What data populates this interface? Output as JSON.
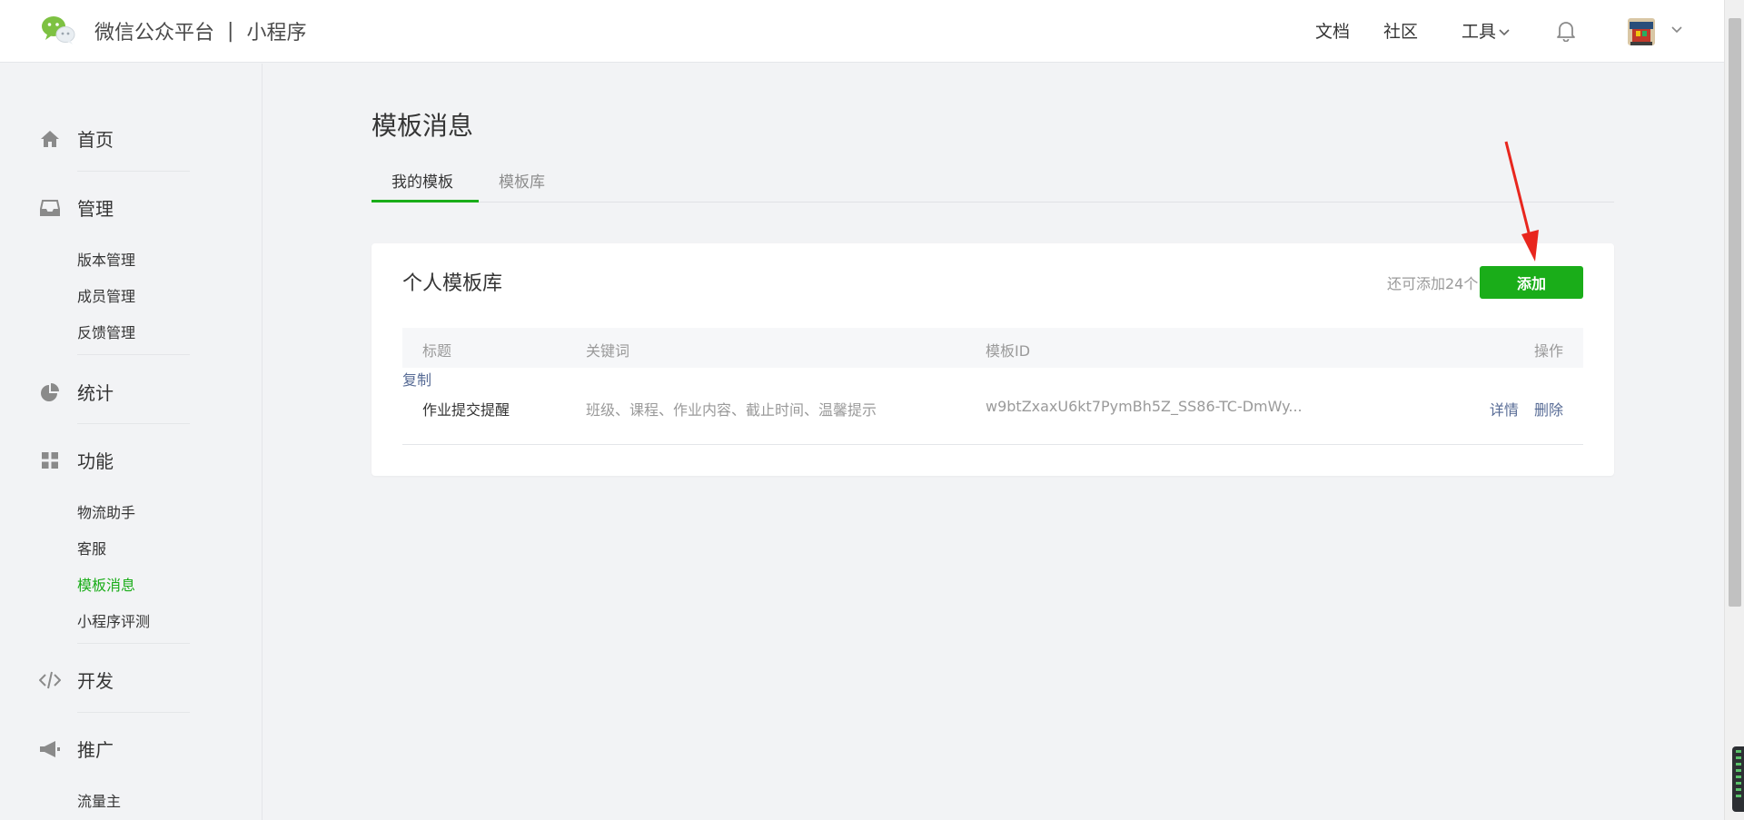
{
  "header": {
    "brand_name": "微信公众平台",
    "brand_separator": "|",
    "brand_product": "小程序",
    "nav": {
      "docs": "文档",
      "community": "社区",
      "tools": "工具"
    }
  },
  "sidebar": {
    "sections": [
      {
        "label": "首页",
        "icon": "home-icon"
      },
      {
        "label": "管理",
        "icon": "inbox-icon",
        "items": [
          "版本管理",
          "成员管理",
          "反馈管理"
        ]
      },
      {
        "label": "统计",
        "icon": "pie-chart-icon"
      },
      {
        "label": "功能",
        "icon": "grid-icon",
        "items": [
          "物流助手",
          "客服",
          "模板消息",
          "小程序评测"
        ]
      },
      {
        "label": "开发",
        "icon": "code-icon"
      },
      {
        "label": "推广",
        "icon": "megaphone-icon",
        "items": [
          "流量主"
        ]
      }
    ],
    "active_item": "模板消息"
  },
  "main": {
    "title": "模板消息",
    "tabs": [
      {
        "label": "我的模板",
        "active": true
      },
      {
        "label": "模板库",
        "active": false
      }
    ],
    "card": {
      "title": "个人模板库",
      "quota_text": "还可添加24个",
      "add_button": "添加",
      "columns": {
        "title": "标题",
        "keywords": "关键词",
        "template_id": "模板ID",
        "actions": "操作"
      },
      "rows": [
        {
          "title": "作业提交提醒",
          "keywords": "班级、课程、作业内容、截止时间、温馨提示",
          "template_id": "w9btZxaxU6kt7PymBh5Z_SS86-TC-DmWy...",
          "copy": "复制",
          "detail": "详情",
          "delete": "删除"
        }
      ]
    }
  },
  "colors": {
    "accent": "#1aad19",
    "link": "#576b95",
    "annotation_arrow": "#e8261e"
  }
}
